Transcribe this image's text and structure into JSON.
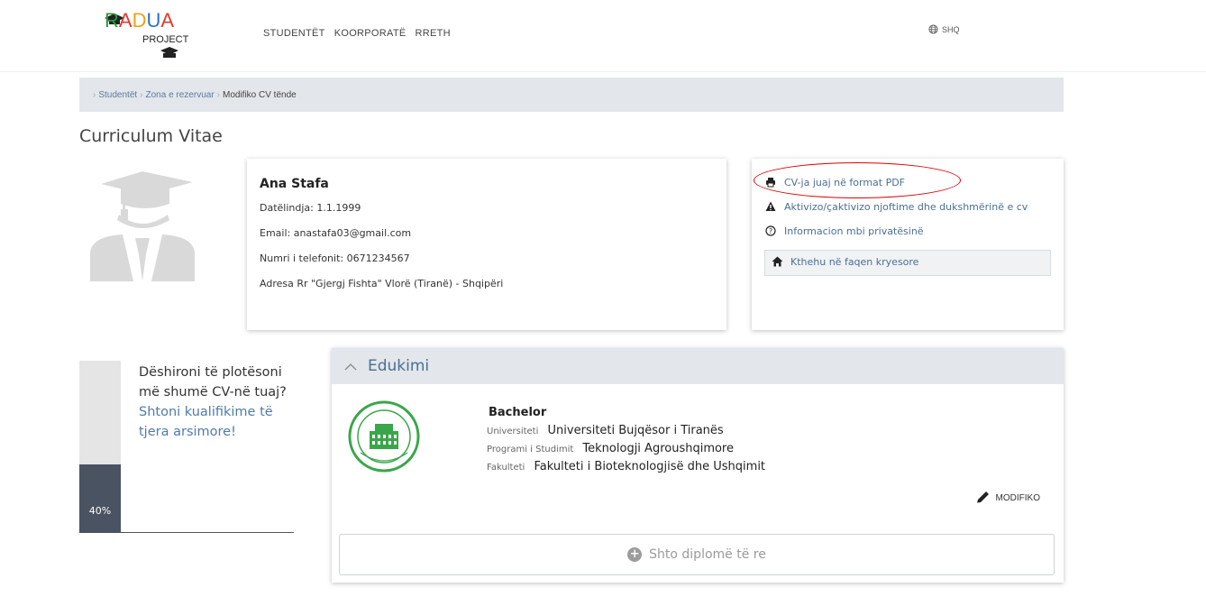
{
  "header": {
    "logo_text": "GRADUA",
    "logo_sub": "PROJECT",
    "nav": [
      "STUDENTËT",
      "KOORPORATË",
      "RRETH"
    ],
    "language": "SHQ"
  },
  "breadcrumb": {
    "items": [
      "Studentët",
      "Zona e rezervuar"
    ],
    "current": "Modifiko CV tënde"
  },
  "page_title": "Curriculum Vitae",
  "profile": {
    "name": "Ana Stafa",
    "birthdate": "Datëlindja: 1.1.1999",
    "email": "Email: anastafa03@gmail.com",
    "phone": "Numri i telefonit: 0671234567",
    "address": "Adresa Rr \"Gjergj Fishta\" Vlorë (Tiranë) - Shqipëri"
  },
  "actions": {
    "pdf": "CV-ja juaj në format PDF",
    "notifications": "Aktivizo/çaktivizo njoftime dhe dukshmërinë e cv",
    "privacy": "Informacion mbi privatësinë",
    "home": "Kthehu në faqen kryesore"
  },
  "progress": {
    "value": 0.4,
    "label": "40%"
  },
  "promo": {
    "text": "Dëshironi të plotësoni më shumë CV-në tuaj?",
    "cta": "Shtoni kualifikime të tjera arsimore!"
  },
  "education": {
    "title": "Edukimi",
    "degree": "Bachelor",
    "university_label": "Universiteti",
    "university": "Universiteti Bujqësor i Tiranës",
    "program_label": "Programi i Studimit",
    "program": "Teknologji Agroushqimore",
    "faculty_label": "Fakulteti",
    "faculty": "Fakulteti i Bioteknologjisë dhe Ushqimit",
    "edit_label": "MODIFIKO",
    "add_label": "Shto diplomë të re"
  },
  "colors": {
    "accent": "#4a6f95",
    "progress_fill": "#4a5362",
    "seal_green": "#3aa64a"
  }
}
